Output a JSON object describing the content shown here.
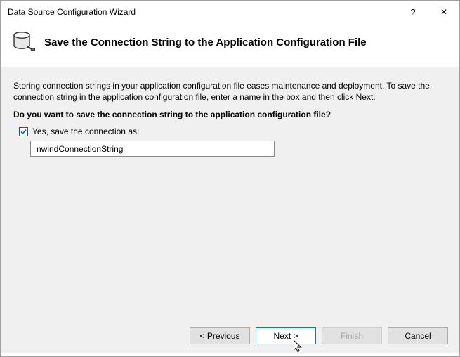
{
  "titlebar": {
    "title": "Data Source Configuration Wizard",
    "help": "?",
    "close": "✕"
  },
  "header": {
    "title": "Save the Connection String to the Application Configuration File"
  },
  "content": {
    "description": "Storing connection strings in your application configuration file eases maintenance and deployment. To save the connection string in the application configuration file, enter a name in the box and then click Next.",
    "question": "Do you want to save the connection string to the application configuration file?",
    "checkbox_label": "Yes, save the connection as:",
    "input_value": "nwindConnectionString"
  },
  "footer": {
    "previous": "< Previous",
    "next": "Next >",
    "finish": "Finish",
    "cancel": "Cancel"
  }
}
